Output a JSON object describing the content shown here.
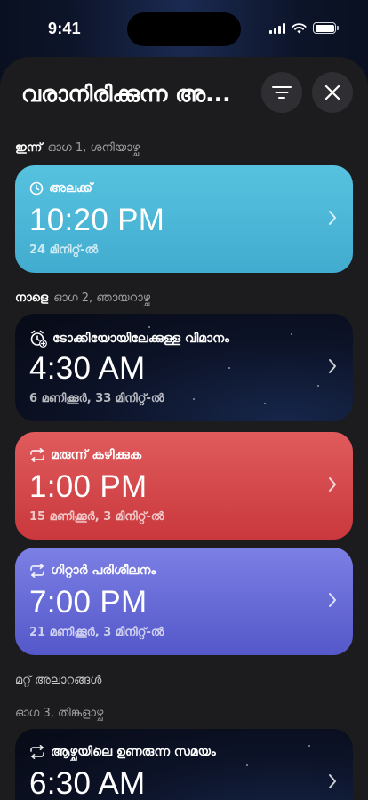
{
  "status_bar": {
    "time": "9:41"
  },
  "header": {
    "title": "വരാനിരിക്കുന്ന അ..."
  },
  "sections": [
    {
      "day": "ഇന്ന്",
      "date": "ഓഗ 1, ശനിയാഴ്ച"
    },
    {
      "day": "നാളെ",
      "date": "ഓഗ 2, ഞായറാഴ്ച"
    },
    {
      "heading": "മറ്റ് അലാറങ്ങൾ"
    },
    {
      "date": "ഓഗ 3, തിങ്കളാഴ്ച"
    }
  ],
  "alarms": [
    {
      "label": "അലക്ക്",
      "time": "10:20 PM",
      "countdown": "24 മിനിറ്റ്-ൽ",
      "icon": "clock-icon"
    },
    {
      "label": "ടോക്കിയോയിലേക്കുള്ള വിമാനം",
      "time": "4:30 AM",
      "countdown": "6 മണിക്കൂർ, 33 മിനിറ്റ്-ൽ",
      "icon": "alarm-clock-add-icon"
    },
    {
      "label": "മരുന്ന് കഴിക്കുക",
      "time": "1:00 PM",
      "countdown": "15 മണിക്കൂർ, 3 മിനിറ്റ്-ൽ",
      "icon": "repeat-icon"
    },
    {
      "label": "ഗിറ്റാർ പരിശീലനം",
      "time": "7:00 PM",
      "countdown": "21 മണിക്കൂർ, 3 മിനിറ്റ്-ൽ",
      "icon": "repeat-icon"
    },
    {
      "label": "ആഴ്ചയിലെ ഉണരുന്ന സമയം",
      "time": "6:30 AM",
      "icon": "repeat-icon"
    }
  ],
  "colors": {
    "sheet_bg": "#1c1c1e",
    "card_blue": "#4cb8d6",
    "card_red": "#d9484b",
    "card_purple": "#6a6dd8",
    "card_night": "#0c1226"
  }
}
